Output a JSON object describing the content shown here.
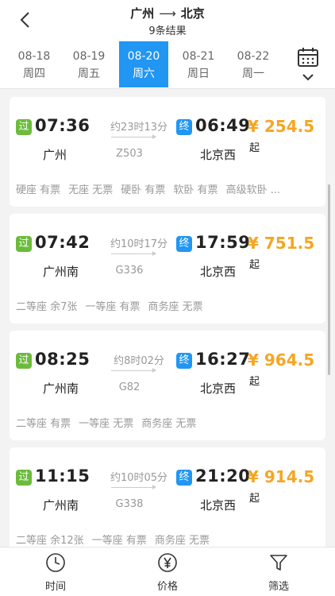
{
  "header": {
    "from": "广州",
    "to": "北京",
    "arrow": "⟶",
    "result_count": "9条结果"
  },
  "dates": [
    {
      "date": "08-18",
      "weekday": "周四"
    },
    {
      "date": "08-19",
      "weekday": "周五"
    },
    {
      "date": "08-20",
      "weekday": "周六"
    },
    {
      "date": "08-21",
      "weekday": "周日"
    },
    {
      "date": "08-22",
      "weekday": "周一"
    }
  ],
  "selected_date": "08-20",
  "trains": [
    {
      "depart_badge": "过",
      "depart_time": "07:36",
      "duration": "约23时13分",
      "train_no": "Z503",
      "arrive_badge": "终",
      "arrive_time": "06:49",
      "price": "¥ 254.5",
      "price_suffix": "起",
      "from_station": "广州",
      "to_station": "北京西",
      "seats": [
        "硬座 有票",
        "无座 无票",
        "硬卧 有票",
        "软卧 有票",
        "高级软卧 ..."
      ]
    },
    {
      "depart_badge": "过",
      "depart_time": "07:42",
      "duration": "约10时17分",
      "train_no": "G336",
      "arrive_badge": "终",
      "arrive_time": "17:59",
      "price": "¥ 751.5",
      "price_suffix": "起",
      "from_station": "广州南",
      "to_station": "北京西",
      "seats": [
        "二等座 余7张",
        "一等座 有票",
        "商务座 无票"
      ]
    },
    {
      "depart_badge": "过",
      "depart_time": "08:25",
      "duration": "约8时02分",
      "train_no": "G82",
      "arrive_badge": "终",
      "arrive_time": "16:27",
      "price": "¥ 964.5",
      "price_suffix": "起",
      "from_station": "广州南",
      "to_station": "北京西",
      "seats": [
        "二等座 有票",
        "一等座 无票",
        "商务座 无票"
      ]
    },
    {
      "depart_badge": "过",
      "depart_time": "11:15",
      "duration": "约10时05分",
      "train_no": "G338",
      "arrive_badge": "终",
      "arrive_time": "21:20",
      "price": "¥ 914.5",
      "price_suffix": "起",
      "from_station": "广州南",
      "to_station": "北京西",
      "seats": [
        "二等座 余12张",
        "一等座 有票",
        "商务座 无票"
      ]
    }
  ],
  "bottom_tabs": [
    {
      "label": "时间",
      "icon": "clock-icon"
    },
    {
      "label": "价格",
      "icon": "yen-icon"
    },
    {
      "label": "筛选",
      "icon": "filter-icon"
    }
  ],
  "colors": {
    "accent": "#2196f3",
    "price": "#f5a623",
    "pass_badge": "#6cbb3c"
  }
}
